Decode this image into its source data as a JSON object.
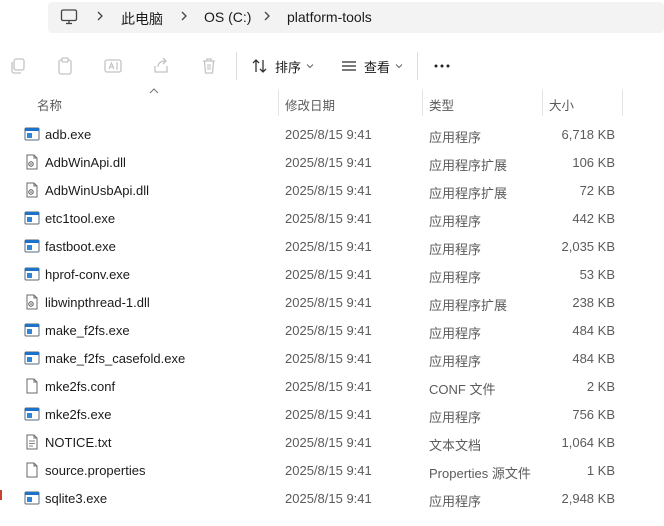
{
  "addressbar": {
    "icon": "monitor-icon",
    "crumbs": [
      "此电脑",
      "OS (C:)",
      "platform-tools"
    ]
  },
  "toolbar": {
    "icons": [
      "copy-icon",
      "paste-icon",
      "rename-icon",
      "share-icon",
      "delete-icon"
    ],
    "sort_label": "排序",
    "view_label": "查看",
    "more_label": "···"
  },
  "columns": {
    "name": "名称",
    "date": "修改日期",
    "type": "类型",
    "size": "大小"
  },
  "files": [
    {
      "name": "adb.exe",
      "date": "2025/8/15 9:41",
      "type": "应用程序",
      "size": "6,718 KB",
      "icon": "exe-icon"
    },
    {
      "name": "AdbWinApi.dll",
      "date": "2025/8/15 9:41",
      "type": "应用程序扩展",
      "size": "106 KB",
      "icon": "dll-icon"
    },
    {
      "name": "AdbWinUsbApi.dll",
      "date": "2025/8/15 9:41",
      "type": "应用程序扩展",
      "size": "72 KB",
      "icon": "dll-icon"
    },
    {
      "name": "etc1tool.exe",
      "date": "2025/8/15 9:41",
      "type": "应用程序",
      "size": "442 KB",
      "icon": "exe-icon"
    },
    {
      "name": "fastboot.exe",
      "date": "2025/8/15 9:41",
      "type": "应用程序",
      "size": "2,035 KB",
      "icon": "exe-icon"
    },
    {
      "name": "hprof-conv.exe",
      "date": "2025/8/15 9:41",
      "type": "应用程序",
      "size": "53 KB",
      "icon": "exe-icon"
    },
    {
      "name": "libwinpthread-1.dll",
      "date": "2025/8/15 9:41",
      "type": "应用程序扩展",
      "size": "238 KB",
      "icon": "dll-icon"
    },
    {
      "name": "make_f2fs.exe",
      "date": "2025/8/15 9:41",
      "type": "应用程序",
      "size": "484 KB",
      "icon": "exe-icon"
    },
    {
      "name": "make_f2fs_casefold.exe",
      "date": "2025/8/15 9:41",
      "type": "应用程序",
      "size": "484 KB",
      "icon": "exe-icon"
    },
    {
      "name": "mke2fs.conf",
      "date": "2025/8/15 9:41",
      "type": "CONF 文件",
      "size": "2 KB",
      "icon": "file-icon"
    },
    {
      "name": "mke2fs.exe",
      "date": "2025/8/15 9:41",
      "type": "应用程序",
      "size": "756 KB",
      "icon": "exe-icon"
    },
    {
      "name": "NOTICE.txt",
      "date": "2025/8/15 9:41",
      "type": "文本文档",
      "size": "1,064 KB",
      "icon": "text-file-icon"
    },
    {
      "name": "source.properties",
      "date": "2025/8/15 9:41",
      "type": "Properties 源文件",
      "size": "1 KB",
      "icon": "file-icon"
    },
    {
      "name": "sqlite3.exe",
      "date": "2025/8/15 9:41",
      "type": "应用程序",
      "size": "2,948 KB",
      "icon": "exe-icon"
    }
  ]
}
